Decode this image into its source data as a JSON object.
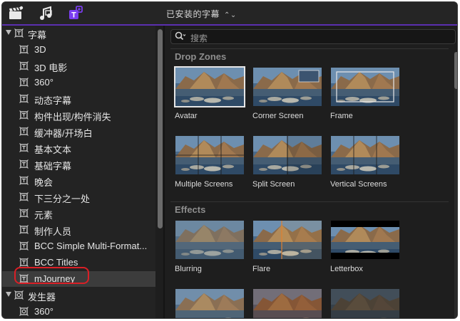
{
  "toolbar": {
    "icons": [
      "clapperboard-icon",
      "music-photo-icon",
      "titles-generators-icon"
    ],
    "dropdown_label": "已安装的字幕",
    "accent": "#5b2fb0"
  },
  "sidebar": {
    "items": [
      {
        "label": "字幕",
        "level": 0,
        "expanded": true,
        "icon": "titles-icon"
      },
      {
        "label": "3D",
        "level": 1,
        "icon": "titles-icon"
      },
      {
        "label": "3D 电影",
        "level": 1,
        "icon": "titles-icon"
      },
      {
        "label": "360°",
        "level": 1,
        "icon": "titles-icon"
      },
      {
        "label": "动态字幕",
        "level": 1,
        "icon": "titles-icon"
      },
      {
        "label": "构件出现/构件消失",
        "level": 1,
        "icon": "titles-icon"
      },
      {
        "label": "缓冲器/开场白",
        "level": 1,
        "icon": "titles-icon"
      },
      {
        "label": "基本文本",
        "level": 1,
        "icon": "titles-icon"
      },
      {
        "label": "基础字幕",
        "level": 1,
        "icon": "titles-icon"
      },
      {
        "label": "晚会",
        "level": 1,
        "icon": "titles-icon"
      },
      {
        "label": "下三分之一处",
        "level": 1,
        "icon": "titles-icon"
      },
      {
        "label": "元素",
        "level": 1,
        "icon": "titles-icon"
      },
      {
        "label": "制作人员",
        "level": 1,
        "icon": "titles-icon"
      },
      {
        "label": "BCC Simple Multi-Format...",
        "level": 1,
        "icon": "titles-icon"
      },
      {
        "label": "BCC Titles",
        "level": 1,
        "icon": "titles-icon"
      },
      {
        "label": "mJourney",
        "level": 1,
        "icon": "titles-icon",
        "selected": true,
        "annotated": true
      },
      {
        "label": "发生器",
        "level": 0,
        "expanded": true,
        "icon": "generators-icon"
      },
      {
        "label": "360°",
        "level": 1,
        "icon": "generators-icon"
      }
    ],
    "annotation_color": "#d91f26"
  },
  "search": {
    "placeholder": "搜索"
  },
  "sections": [
    {
      "title": "Drop Zones",
      "tiles": [
        {
          "name": "Avatar",
          "selected": true
        },
        {
          "name": "Corner Screen"
        },
        {
          "name": "Frame"
        },
        {
          "name": "Multiple Screens"
        },
        {
          "name": "Split Screen"
        },
        {
          "name": "Vertical Screens"
        }
      ]
    },
    {
      "title": "Effects",
      "tiles": [
        {
          "name": "Blurring"
        },
        {
          "name": "Flare"
        },
        {
          "name": "Letterbox"
        },
        {
          "name": ""
        },
        {
          "name": ""
        },
        {
          "name": ""
        }
      ]
    }
  ]
}
